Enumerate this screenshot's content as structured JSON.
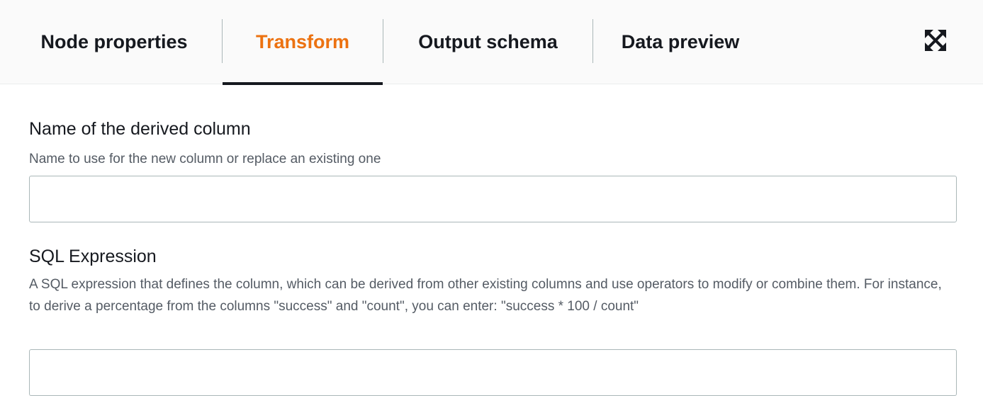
{
  "tabs": [
    {
      "label": "Node properties",
      "active": false
    },
    {
      "label": "Transform",
      "active": true
    },
    {
      "label": "Output schema",
      "active": false
    },
    {
      "label": "Data preview",
      "active": false
    }
  ],
  "toolbar": {
    "expand_icon": "expand-arrows-icon"
  },
  "colors": {
    "accent": "#ec7211",
    "text": "#16191f",
    "muted": "#545b64",
    "border": "#aab7b8"
  },
  "form": {
    "derived_column": {
      "label": "Name of the derived column",
      "description": "Name to use for the new column or replace an existing one",
      "value": ""
    },
    "sql_expression": {
      "label": "SQL Expression",
      "description": "A SQL expression that defines the column, which can be derived from other existing columns and use operators to modify or combine them. For instance, to derive a percentage from the columns \"success\" and \"count\", you can enter: \"success * 100 / count\"",
      "value": ""
    }
  }
}
